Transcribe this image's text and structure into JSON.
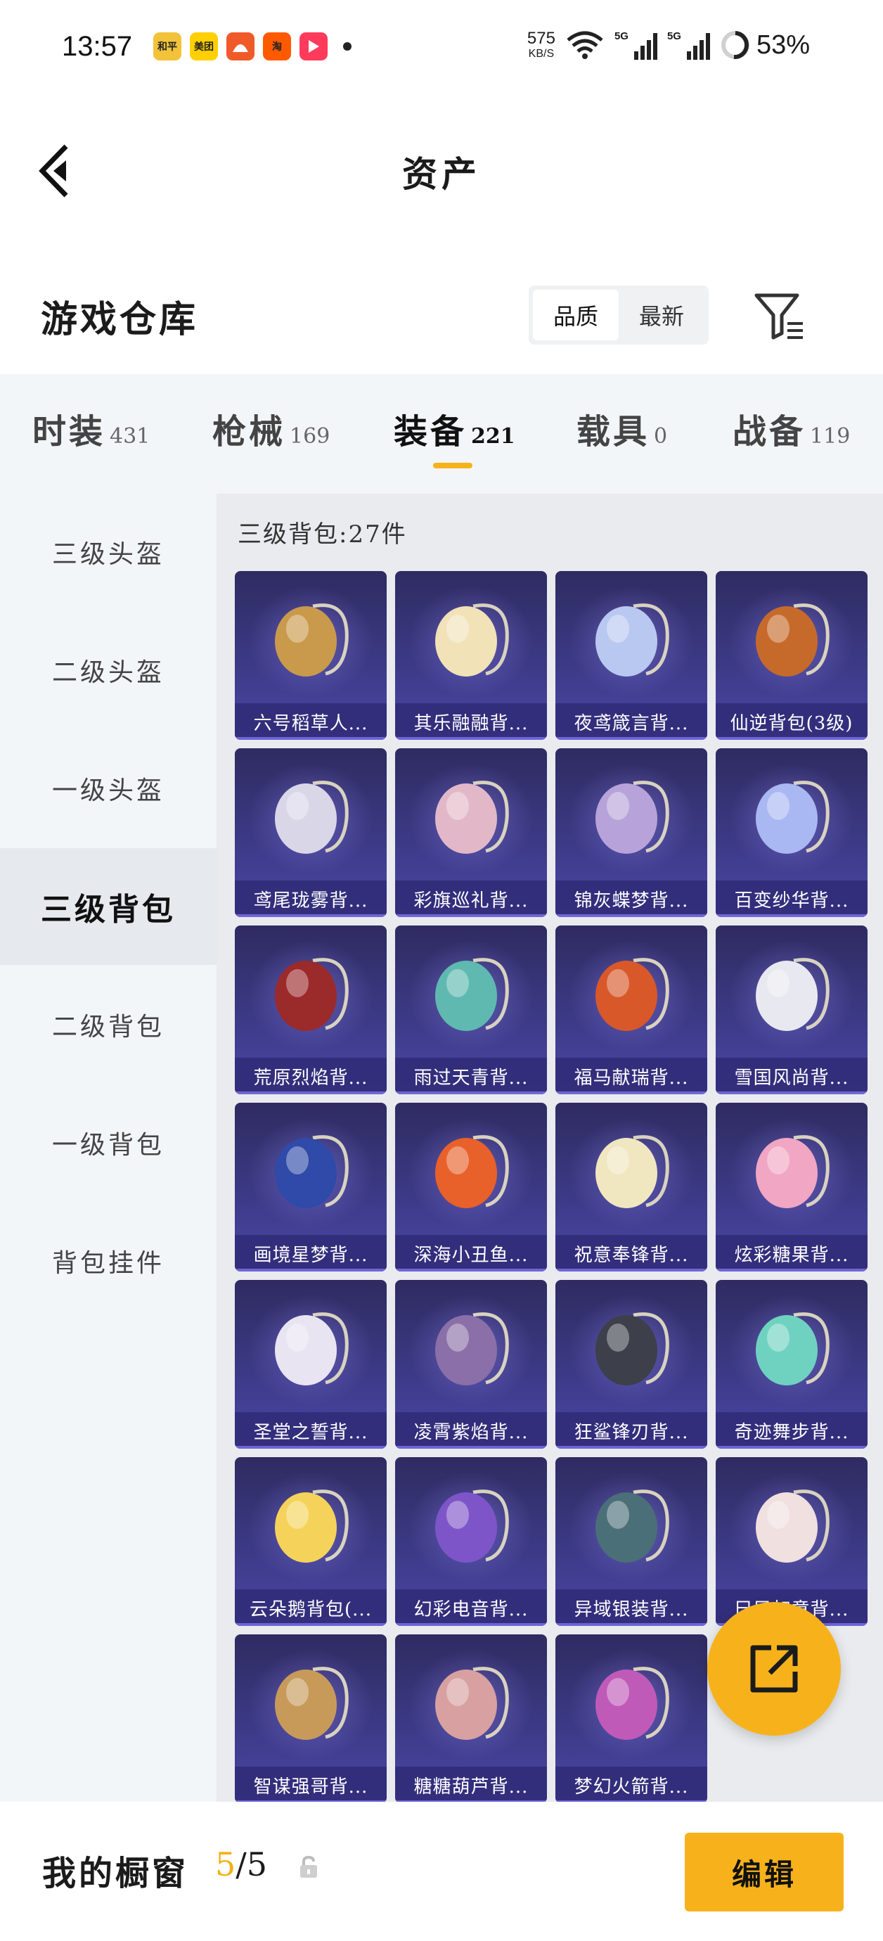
{
  "status_bar": {
    "time": "13:57",
    "apps": [
      {
        "icon": "game-app-icon",
        "text": "和平",
        "color": "#f2c23a"
      },
      {
        "icon": "meituan-app-icon",
        "text": "美团",
        "color": "#ffd000"
      },
      {
        "icon": "robot-app-icon",
        "text": "",
        "color": "#f05a28"
      },
      {
        "icon": "taobao-app-icon",
        "text": "淘",
        "color": "#ff5a00"
      },
      {
        "icon": "video-app-icon",
        "text": "",
        "color": "#ff3b5c"
      }
    ],
    "speed_value": "575",
    "speed_unit": "KB/S",
    "signal_tag": "5G",
    "battery": "53%"
  },
  "nav": {
    "title": "资产"
  },
  "section": {
    "title": "游戏仓库",
    "sort_options": [
      "品质",
      "最新"
    ],
    "sort_active": "品质"
  },
  "tabs": [
    {
      "label": "时装",
      "count": "431"
    },
    {
      "label": "枪械",
      "count": "169"
    },
    {
      "label": "装备",
      "count": "221"
    },
    {
      "label": "载具",
      "count": "0"
    },
    {
      "label": "战备",
      "count": "119"
    }
  ],
  "active_tab": "装备",
  "sidebar": {
    "items": [
      "三级头盔",
      "二级头盔",
      "一级头盔",
      "三级背包",
      "二级背包",
      "一级背包",
      "背包挂件"
    ],
    "active": "三级背包"
  },
  "main": {
    "count_label": "三级背包:27件",
    "items": [
      {
        "name": "六号稻草人...",
        "icon": "scarecrow-backpack-icon",
        "color": "#c99a4b"
      },
      {
        "name": "其乐融融背...",
        "icon": "bunny-backpack-icon",
        "color": "#f1e2b8"
      },
      {
        "name": "夜鸢箴言背...",
        "icon": "jellyfish-backpack-icon",
        "color": "#b9c8f0"
      },
      {
        "name": "仙逆背包(3级)",
        "icon": "phoenix-backpack-icon",
        "color": "#c66a2c"
      },
      {
        "name": "鸢尾珑雾背...",
        "icon": "iris-backpack-icon",
        "color": "#d9d6e8"
      },
      {
        "name": "彩旗巡礼背...",
        "icon": "flag-backpack-icon",
        "color": "#e2b8c8"
      },
      {
        "name": "锦灰蝶梦背...",
        "icon": "butterfly-backpack-icon",
        "color": "#b7a3d9"
      },
      {
        "name": "百变纱华背...",
        "icon": "flower-backpack-icon",
        "color": "#a9b7f2"
      },
      {
        "name": "荒原烈焰背...",
        "icon": "flame-backpack-icon",
        "color": "#9b2a2a"
      },
      {
        "name": "雨过天青背...",
        "icon": "lotus-backpack-icon",
        "color": "#5fb9b0"
      },
      {
        "name": "福马献瑞背...",
        "icon": "horse-backpack-icon",
        "color": "#d8582a"
      },
      {
        "name": "雪国风尚背...",
        "icon": "penguin-backpack-icon",
        "color": "#e8e8f0"
      },
      {
        "name": "画境星梦背...",
        "icon": "star-frame-backpack-icon",
        "color": "#2f4aa8"
      },
      {
        "name": "深海小丑鱼...",
        "icon": "clownfish-backpack-icon",
        "color": "#e8602a"
      },
      {
        "name": "祝意奉锋背...",
        "icon": "cake-backpack-icon",
        "color": "#f0e6c0"
      },
      {
        "name": "炫彩糖果背...",
        "icon": "donut-backpack-icon",
        "color": "#f1a6c4"
      },
      {
        "name": "圣堂之誓背...",
        "icon": "wings-backpack-icon",
        "color": "#e9e4f2"
      },
      {
        "name": "凌霄紫焰背...",
        "icon": "purple-flame-backpack-icon",
        "color": "#8a6fa8"
      },
      {
        "name": "狂鲨锋刃背...",
        "icon": "shark-backpack-icon",
        "color": "#3d3f4a"
      },
      {
        "name": "奇迹舞步背...",
        "icon": "swan-backpack-icon",
        "color": "#6fd2c0"
      },
      {
        "name": "云朵鹅背包(...",
        "icon": "duck-backpack-icon",
        "color": "#f5d35a"
      },
      {
        "name": "幻彩电音背...",
        "icon": "speaker-backpack-icon",
        "color": "#7e55c9"
      },
      {
        "name": "异域银装背...",
        "icon": "armor-backpack-icon",
        "color": "#4a6f78"
      },
      {
        "name": "巳巳如意背...",
        "icon": "snake-backpack-icon",
        "color": "#f0e0e0"
      },
      {
        "name": "智谋强哥背...",
        "icon": "bear-backpack-icon",
        "color": "#c89a5a"
      },
      {
        "name": "糖糖葫芦背...",
        "icon": "gourd-backpack-icon",
        "color": "#d8a0a0"
      },
      {
        "name": "梦幻火箭背...",
        "icon": "rocket-backpack-icon",
        "color": "#c05ab8"
      }
    ]
  },
  "bottom": {
    "title": "我的橱窗",
    "current": "5",
    "separator": "/",
    "total": "5",
    "edit_label": "编辑"
  },
  "colors": {
    "accent": "#f7b21b",
    "card_bg": "#3c3a86",
    "panel_bg": "#e9ebee",
    "sidebar_bg": "#f3f6f9"
  }
}
